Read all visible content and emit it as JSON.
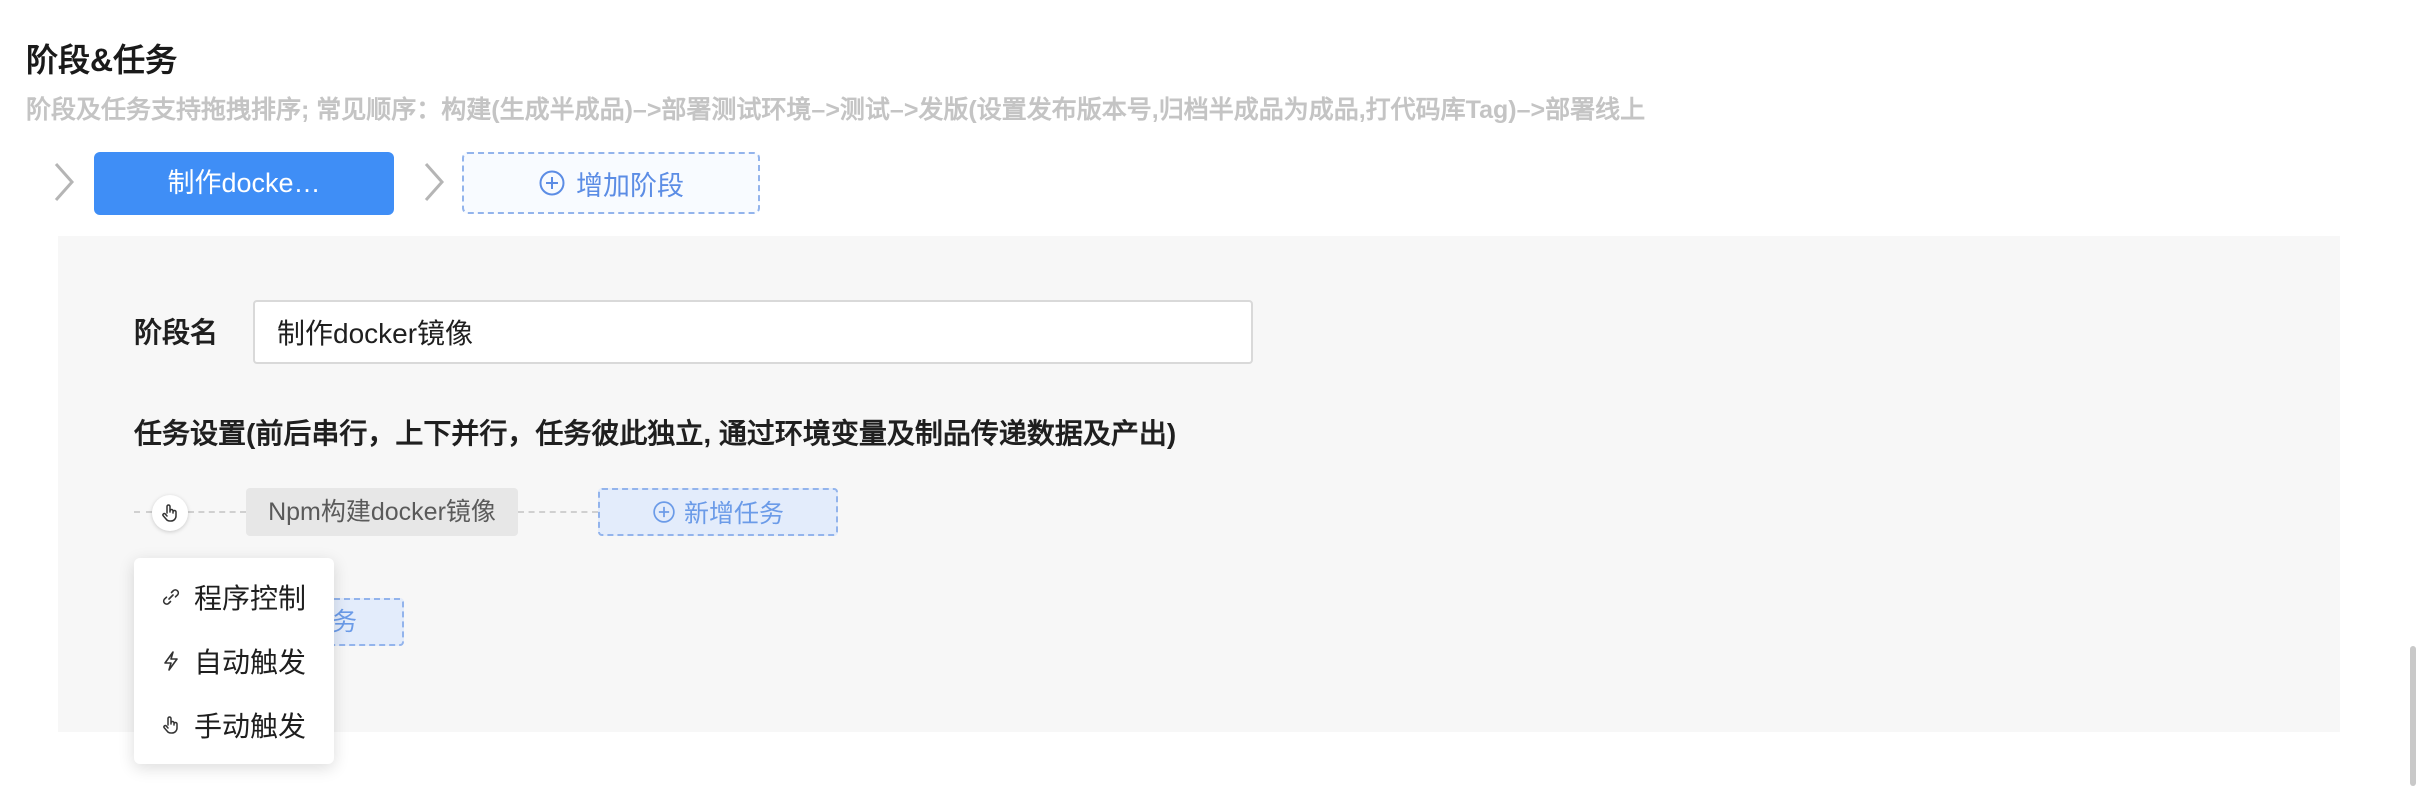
{
  "section": {
    "title": "阶段&任务",
    "description": "阶段及任务支持拖拽排序; 常见顺序：构建(生成半成品)–>部署测试环境–>测试–>发版(设置发布版本号,归档半成品为成品,打代码库Tag)–>部署线上"
  },
  "stages": {
    "tabs": [
      {
        "label": "制作docke…"
      }
    ],
    "add_label": "增加阶段"
  },
  "stage_form": {
    "name_label": "阶段名",
    "name_value": "制作docker镜像"
  },
  "tasks": {
    "heading": "任务设置(前后串行，上下并行，任务彼此独立, 通过环境变量及制品传递数据及产出)",
    "items": [
      {
        "label": "Npm构建docker镜像"
      }
    ],
    "add_label": "新增任务",
    "add_label_partial": "务"
  },
  "trigger_menu": {
    "items": [
      {
        "label": "程序控制",
        "icon": "link-icon"
      },
      {
        "label": "自动触发",
        "icon": "lightning-icon"
      },
      {
        "label": "手动触发",
        "icon": "hand-pointer-icon"
      }
    ]
  },
  "colors": {
    "accent": "#3f8ef6",
    "dashed_accent": "#93b4ec",
    "panel_bg": "#f7f7f7"
  }
}
